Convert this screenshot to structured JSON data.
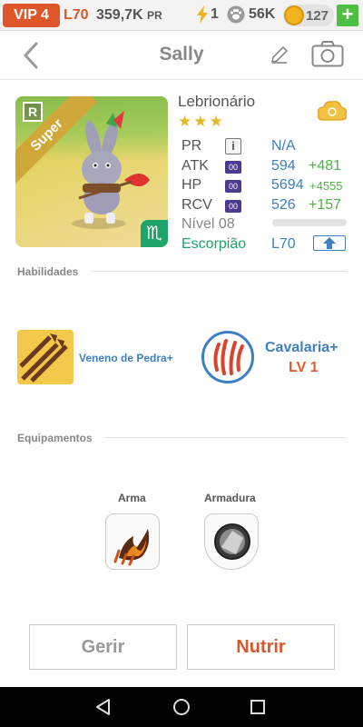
{
  "status_bar": {
    "vip": "VIP 4",
    "player_level": "L70",
    "power_value": "359,7K",
    "power_unit": "PR",
    "energy": "1",
    "paw_currency": "56K",
    "gold": "127",
    "add_label": "+"
  },
  "header": {
    "title": "Sally"
  },
  "monster": {
    "rarity_badge": "R",
    "variant_label": "Super",
    "zodiac_symbol": "♏",
    "name": "Lebrionário",
    "stars": "★★★"
  },
  "stats": {
    "pr_label": "PR",
    "pr_info": "i",
    "pr_value": "N/A",
    "atk_label": "ATK",
    "atk_chip": "00",
    "atk_value": "594",
    "atk_bonus": "+481",
    "hp_label": "HP",
    "hp_chip": "00",
    "hp_value": "5694",
    "hp_bonus": "+4555",
    "rcv_label": "RCV",
    "rcv_chip": "00",
    "rcv_value": "526",
    "rcv_bonus": "+157",
    "level_label": "Nível 08",
    "level_progress": 0,
    "element_label": "Escorpião",
    "level_cap": "L70"
  },
  "abilities": {
    "section_title": "Habilidades",
    "ability_1": "Veneno de Pedra+",
    "ability_2": "Cavalaria+",
    "ability_2_level": "LV 1"
  },
  "equipment": {
    "section_title": "Equipamentos",
    "weapon_label": "Arma",
    "armor_label": "Armadura"
  },
  "actions": {
    "manage": "Gerir",
    "feed": "Nutrir"
  },
  "colors": {
    "accent_orange": "#e0562b",
    "accent_blue": "#3e7fc4",
    "accent_green": "#4cb542",
    "element_green": "#1fa46a"
  }
}
